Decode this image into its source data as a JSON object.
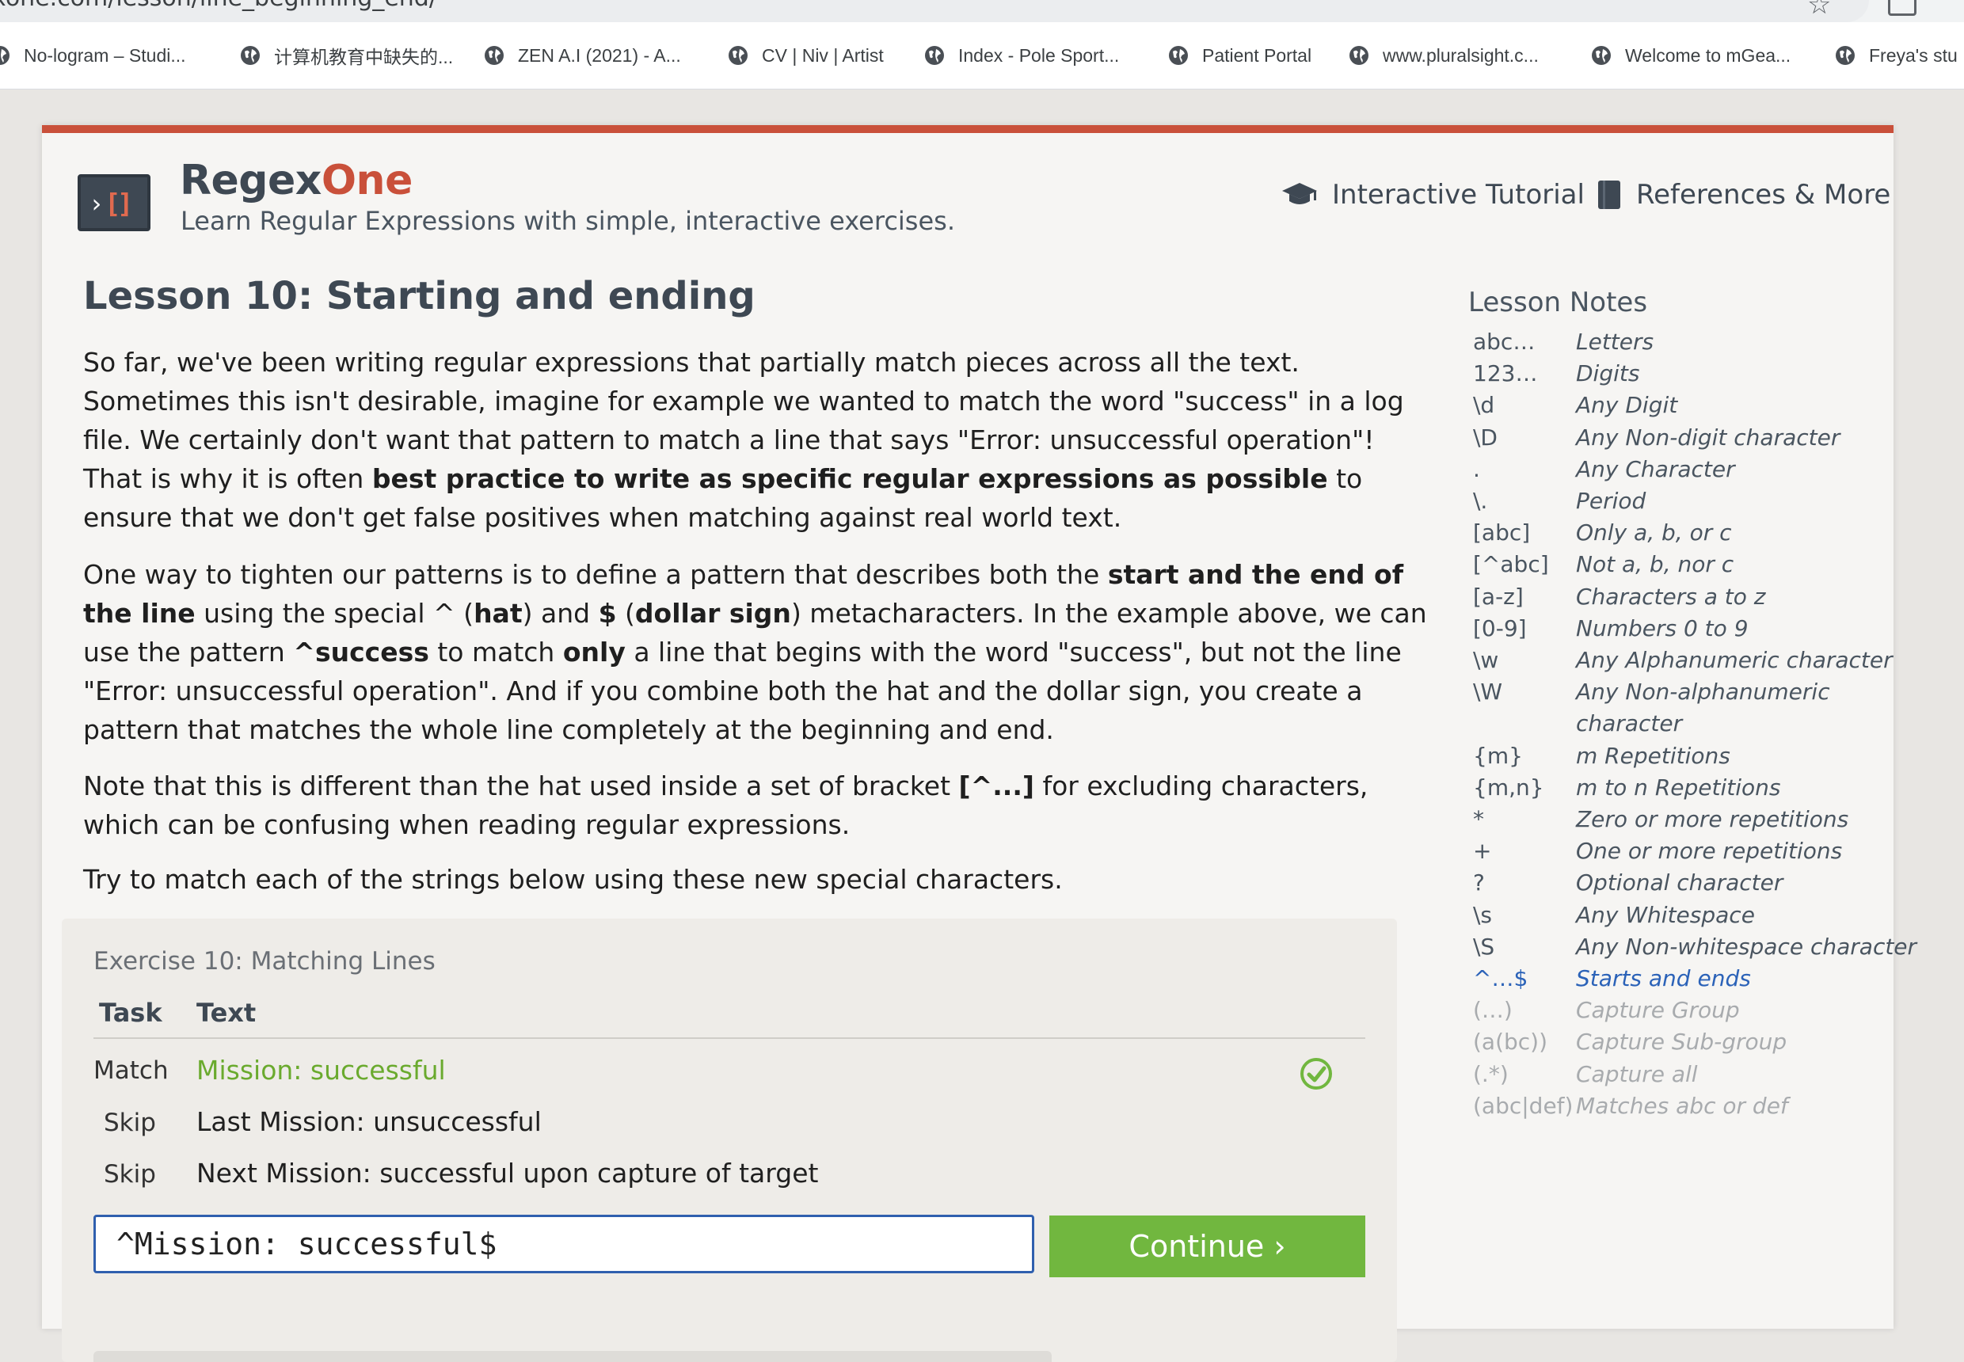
{
  "browser": {
    "url_fragment": "xone.com/lesson/line_beginning_end/",
    "bookmarks": [
      "No-logram – Studi...",
      "计算机教育中缺失的...",
      "ZEN A.I (2021) - A...",
      "CV | Niv | Artist",
      "Index - Pole Sport...",
      "Patient Portal",
      "www.pluralsight.c...",
      "Welcome to mGea...",
      "Freya's stu"
    ]
  },
  "site": {
    "brand_main": "Regex",
    "brand_accent": "One",
    "tagline": "Learn Regular Expressions with simple, interactive exercises.",
    "nav": {
      "tutorial": "Interactive Tutorial",
      "references": "References & More"
    },
    "accent_color": "#c9503a"
  },
  "lesson": {
    "title": "Lesson 10: Starting and ending",
    "p1": [
      "So far, we've been writing regular expressions that partially match pieces across all the text. Sometimes this isn't desirable, imagine for example we wanted to match the word \"success\" in a log file. We certainly don't want that pattern to match a line that says \"Error: unsuccessful operation\"! That is why it is often ",
      "best practice to write as specific regular expressions as possible",
      " to ensure that we don't get false positives when matching against real world text."
    ],
    "p2": [
      "One way to tighten our patterns is to define a pattern that describes both the ",
      "start and the end of the line",
      " using the special ^ (",
      "hat",
      ") and ",
      "$",
      " (",
      "dollar sign",
      ") metacharacters. In the example above, we can use the pattern ",
      "^success",
      " to match ",
      "only",
      " a line that begins with the word \"success\", but not the line \"Error: unsuccessful operation\". And if you combine both the hat and the dollar sign, you create a pattern that matches the whole line completely at the beginning and end."
    ],
    "p3": [
      "Note that this is different than the hat used inside a set of bracket ",
      "[^...]",
      " for excluding characters, which can be confusing when reading regular expressions."
    ],
    "p4": "Try to match each of the strings below using these new special characters."
  },
  "exercise": {
    "title": "Exercise 10: Matching Lines",
    "col_task": "Task",
    "col_text": "Text",
    "rows": [
      {
        "task": "Match",
        "text": "Mission: successful",
        "status": "matched"
      },
      {
        "task": "Skip",
        "text": "Last Mission: unsuccessful"
      },
      {
        "task": "Skip",
        "text": "Next Mission: successful upon capture of target"
      }
    ],
    "input_value": "^Mission: successful$",
    "continue_label": "Continue ›",
    "success_color": "#71b73f"
  },
  "notes": {
    "title": "Lesson Notes",
    "items": [
      {
        "sym": "abc…",
        "desc": "Letters",
        "state": "done"
      },
      {
        "sym": "123…",
        "desc": "Digits",
        "state": "done"
      },
      {
        "sym": "\\d",
        "desc": "Any Digit",
        "state": "done"
      },
      {
        "sym": "\\D",
        "desc": "Any Non-digit character",
        "state": "done"
      },
      {
        "sym": ".",
        "desc": "Any Character",
        "state": "done"
      },
      {
        "sym": "\\.",
        "desc": "Period",
        "state": "done"
      },
      {
        "sym": "[abc]",
        "desc": "Only a, b, or c",
        "state": "done"
      },
      {
        "sym": "[^abc]",
        "desc": "Not a, b, nor c",
        "state": "done"
      },
      {
        "sym": "[a-z]",
        "desc": "Characters a to z",
        "state": "done"
      },
      {
        "sym": "[0-9]",
        "desc": "Numbers 0 to 9",
        "state": "done"
      },
      {
        "sym": "\\w",
        "desc": "Any Alphanumeric character",
        "state": "done"
      },
      {
        "sym": "\\W",
        "desc": "Any Non-alphanumeric",
        "desc2": "character",
        "state": "done"
      },
      {
        "sym": "{m}",
        "desc": "m Repetitions",
        "state": "done"
      },
      {
        "sym": "{m,n}",
        "desc": "m to n Repetitions",
        "state": "done"
      },
      {
        "sym": "*",
        "desc": "Zero or more repetitions",
        "state": "done"
      },
      {
        "sym": "+",
        "desc": "One or more repetitions",
        "state": "done"
      },
      {
        "sym": "?",
        "desc": "Optional character",
        "state": "done"
      },
      {
        "sym": "\\s",
        "desc": "Any Whitespace",
        "state": "done"
      },
      {
        "sym": "\\S",
        "desc": "Any Non-whitespace character",
        "state": "done"
      },
      {
        "sym": "^…$",
        "desc": "Starts and ends",
        "state": "current"
      },
      {
        "sym": "(…)",
        "desc": "Capture Group",
        "state": "future"
      },
      {
        "sym": "(a(bc))",
        "desc": "Capture Sub-group",
        "state": "future"
      },
      {
        "sym": "(.*)",
        "desc": "Capture all",
        "state": "future"
      },
      {
        "sym": "(abc|def)",
        "desc": "Matches abc or def",
        "state": "future"
      }
    ]
  }
}
